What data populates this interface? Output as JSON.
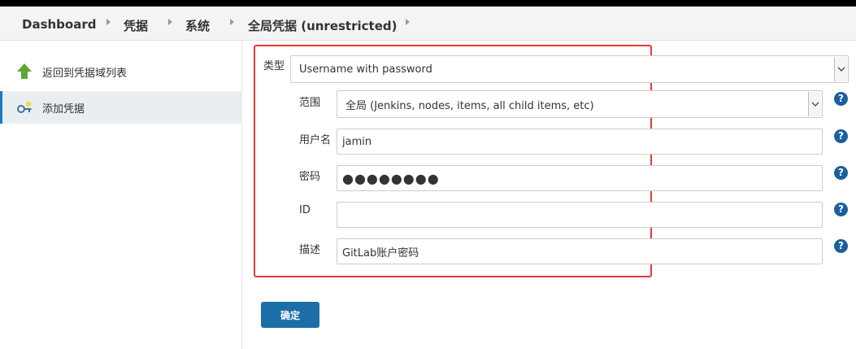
{
  "breadcrumb": {
    "items": [
      "Dashboard",
      "凭据",
      "系统",
      "全局凭据 (unrestricted)"
    ]
  },
  "sidebar": {
    "items": [
      {
        "label": "返回到凭据域列表",
        "icon": "up-arrow-icon"
      },
      {
        "label": "添加凭据",
        "icon": "key-icon"
      }
    ]
  },
  "form": {
    "kind_label": "类型",
    "kind_value": "Username with password",
    "scope_label": "范围",
    "scope_value": "全局 (Jenkins, nodes, items, all child items, etc)",
    "username_label": "用户名",
    "username_value": "jamin",
    "password_label": "密码",
    "password_value": "●●●●●●●●",
    "id_label": "ID",
    "id_value": "",
    "description_label": "描述",
    "description_value": "GitLab账户密码",
    "help_glyph": "?",
    "submit_label": "确定"
  },
  "colors": {
    "accent": "#1b6ea8",
    "highlight_border": "#e53a35",
    "help_icon": "#1a5f9e"
  }
}
